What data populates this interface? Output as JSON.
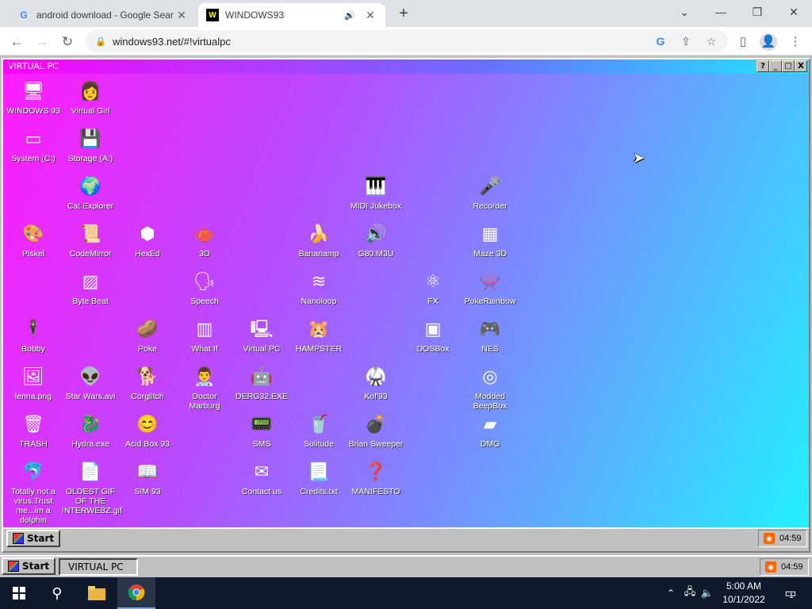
{
  "browser": {
    "tabs": [
      {
        "title": "android download - Google Sear",
        "favicon": "G"
      },
      {
        "title": "WINDOWS93",
        "favicon": "W"
      }
    ],
    "url": "windows93.net/#!virtualpc"
  },
  "vpc": {
    "title": "VIRTUAL PC",
    "buttons": [
      "?",
      "_",
      "□",
      "X"
    ]
  },
  "desktop_icons": [
    {
      "label": "WINDOWS 93",
      "glyph": "🖥"
    },
    {
      "label": "Virtual Girl",
      "glyph": "👩"
    },
    {
      "label": "System (C:)",
      "glyph": "▭"
    },
    {
      "label": "Storage (A:)",
      "glyph": "💾"
    },
    {
      "label": "Cat Explorer",
      "glyph": "🌍"
    },
    {
      "label": "MIDI Jukebox",
      "glyph": "🎹"
    },
    {
      "label": "Recorder",
      "glyph": "🎤"
    },
    {
      "label": "Piskel",
      "glyph": "🎨"
    },
    {
      "label": "CodeMirror",
      "glyph": "📜"
    },
    {
      "label": "HexEd",
      "glyph": "⬢"
    },
    {
      "label": "3D",
      "glyph": "🫖"
    },
    {
      "label": "Bananamp",
      "glyph": "🍌"
    },
    {
      "label": "G80.M3U",
      "glyph": "🔊"
    },
    {
      "label": "Maze 3D",
      "glyph": "▦"
    },
    {
      "label": "Byte Beat",
      "glyph": "▨"
    },
    {
      "label": "Speech",
      "glyph": "🗣"
    },
    {
      "label": "Nanoloop",
      "glyph": "≋"
    },
    {
      "label": "FX",
      "glyph": "⚛"
    },
    {
      "label": "PokeRainbow",
      "glyph": "👾"
    },
    {
      "label": "Bobby",
      "glyph": "🕴"
    },
    {
      "label": "Poke",
      "glyph": "🥔"
    },
    {
      "label": "What If",
      "glyph": "▥"
    },
    {
      "label": "Virtual PC",
      "glyph": "🖳"
    },
    {
      "label": "HAMPSTER",
      "glyph": "🐹"
    },
    {
      "label": "DOSBox",
      "glyph": "▣"
    },
    {
      "label": "NES",
      "glyph": "🎮"
    },
    {
      "label": "lenna.png",
      "glyph": "🖼"
    },
    {
      "label": "Star Wars.avi",
      "glyph": "👽"
    },
    {
      "label": "Corglitch",
      "glyph": "🐕"
    },
    {
      "label": "Doctor Marburg",
      "glyph": "👨‍⚕️"
    },
    {
      "label": "DERG32.EXE",
      "glyph": "🤖"
    },
    {
      "label": "Kof'93",
      "glyph": "🥋"
    },
    {
      "label": "Modded BeepBox",
      "glyph": "◎"
    },
    {
      "label": "TRASH",
      "glyph": "🗑"
    },
    {
      "label": "Hydra.exe",
      "glyph": "🐉"
    },
    {
      "label": "Acid Box 93",
      "glyph": "😊"
    },
    {
      "label": "SMS",
      "glyph": "📟"
    },
    {
      "label": "Solitude",
      "glyph": "🥤"
    },
    {
      "label": "Brian Sweeper",
      "glyph": "💣"
    },
    {
      "label": "DMG",
      "glyph": "▰"
    },
    {
      "label": "Totally not a virus.Trust me...im a dolphin",
      "glyph": "🐬"
    },
    {
      "label": "OLDEST GIF OF THE INTERWEBZ.gif",
      "glyph": "📄"
    },
    {
      "label": "SIM 93",
      "glyph": "📖"
    },
    {
      "label": "Contact us",
      "glyph": "✉"
    },
    {
      "label": "Credits.txt",
      "glyph": "📃"
    },
    {
      "label": "MANIFESTO",
      "glyph": "❓"
    }
  ],
  "inner_taskbar": {
    "start": "Start",
    "time": "04:59"
  },
  "outer_taskbar": {
    "start": "Start",
    "task": "VIRTUAL PC",
    "time": "04:59"
  },
  "windows": {
    "time": "5:00 AM",
    "date": "10/1/2022",
    "notif_count": "1"
  }
}
